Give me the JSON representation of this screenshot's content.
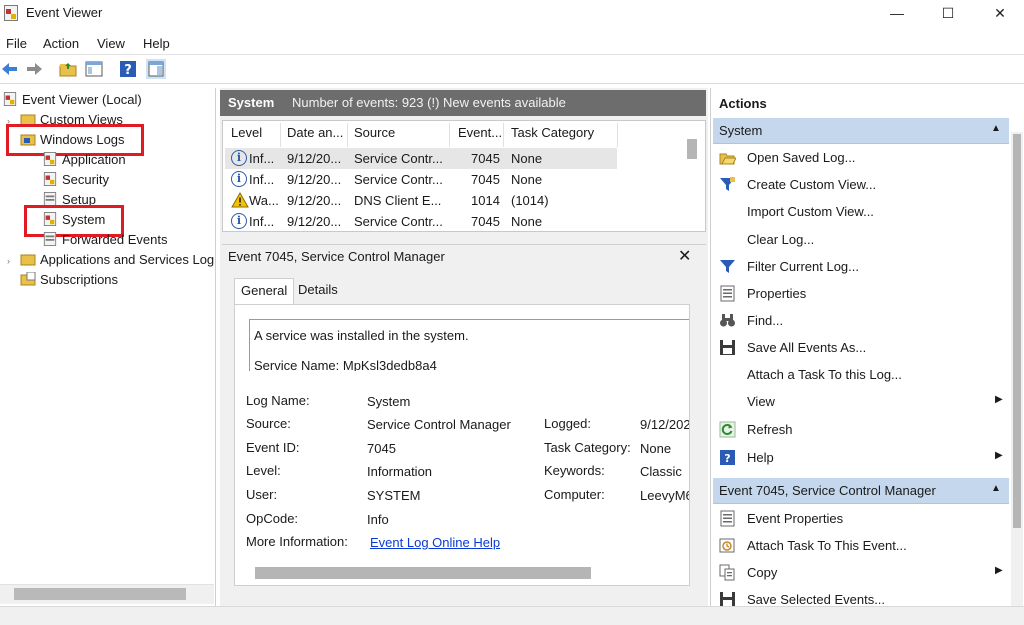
{
  "window": {
    "title": "Event Viewer",
    "controls": {
      "minimize": "—",
      "maximize": "☐",
      "close": "✕"
    }
  },
  "menu": [
    "File",
    "Action",
    "View",
    "Help"
  ],
  "toolbar": [
    "back-icon",
    "forward-icon",
    "folder-up-icon",
    "show-hide-console-tree-icon",
    "help-icon",
    "action-pane-icon"
  ],
  "tree": {
    "root": "Event Viewer (Local)",
    "custom_views": "Custom Views",
    "windows_logs": "Windows Logs",
    "children": [
      "Application",
      "Security",
      "Setup",
      "System",
      "Forwarded Events"
    ],
    "apps_services": "Applications and Services Log",
    "subscriptions": "Subscriptions"
  },
  "log_header": {
    "name": "System",
    "info": "Number of events: 923 (!) New events available"
  },
  "events": {
    "columns": [
      "Level",
      "Date an...",
      "Source",
      "Event...",
      "Task Category"
    ],
    "rows": [
      {
        "level": "Inf...",
        "date": "9/12/20...",
        "source": "Service Contr...",
        "event_id": "7045",
        "category": "None",
        "icon": "info-icon"
      },
      {
        "level": "Inf...",
        "date": "9/12/20...",
        "source": "Service Contr...",
        "event_id": "7045",
        "category": "None",
        "icon": "info-icon"
      },
      {
        "level": "Wa...",
        "date": "9/12/20...",
        "source": "DNS Client E...",
        "event_id": "1014",
        "category": "(1014)",
        "icon": "warning-icon"
      },
      {
        "level": "Inf...",
        "date": "9/12/20...",
        "source": "Service Contr...",
        "event_id": "7045",
        "category": "None",
        "icon": "info-icon"
      }
    ]
  },
  "detail": {
    "title": "Event 7045, Service Control Manager",
    "close": "✕",
    "tabs": [
      "General",
      "Details"
    ],
    "description_line1": "A service was installed in the system.",
    "description_line2": "Service Name:  MpKsl3dedb8a4",
    "fields": {
      "log_name_label": "Log Name:",
      "log_name": "System",
      "source_label": "Source:",
      "source": "Service Control Manager",
      "logged_label": "Logged:",
      "logged": "9/12/202",
      "event_id_label": "Event ID:",
      "event_id": "7045",
      "task_category_label": "Task Category:",
      "task_category": "None",
      "level_label": "Level:",
      "level": "Information",
      "keywords_label": "Keywords:",
      "keywords": "Classic",
      "user_label": "User:",
      "user": "SYSTEM",
      "computer_label": "Computer:",
      "computer": "LeevyM6",
      "opcode_label": "OpCode:",
      "opcode": "Info",
      "more_info_label": "More Information:",
      "more_info_link": "Event Log Online Help"
    }
  },
  "actions": {
    "title": "Actions",
    "section1": "System",
    "section1_items": [
      {
        "label": "Open Saved Log...",
        "icon": "open-folder-icon"
      },
      {
        "label": "Create Custom View...",
        "icon": "filter-icon"
      },
      {
        "label": "Import Custom View...",
        "icon": ""
      },
      {
        "label": "Clear Log...",
        "icon": ""
      },
      {
        "label": "Filter Current Log...",
        "icon": "filter-icon"
      },
      {
        "label": "Properties",
        "icon": "properties-icon"
      },
      {
        "label": "Find...",
        "icon": "binoculars-icon"
      },
      {
        "label": "Save All Events As...",
        "icon": "save-icon"
      },
      {
        "label": "Attach a Task To this Log...",
        "icon": ""
      },
      {
        "label": "View",
        "icon": "",
        "submenu": true
      },
      {
        "label": "Refresh",
        "icon": "refresh-icon"
      },
      {
        "label": "Help",
        "icon": "help-icon",
        "submenu": true
      }
    ],
    "section2": "Event 7045, Service Control Manager",
    "section2_items": [
      {
        "label": "Event Properties",
        "icon": "properties-icon"
      },
      {
        "label": "Attach Task To This Event...",
        "icon": "task-icon"
      },
      {
        "label": "Copy",
        "icon": "copy-icon",
        "submenu": true
      },
      {
        "label": "Save Selected Events...",
        "icon": "save-icon"
      }
    ],
    "submenu_arrow": "▶",
    "collapse_caret": "▲"
  },
  "colors": {
    "highlight_box": "#e01b24",
    "section_header": "#c5d7ec",
    "log_header_bg": "#6d6d6d",
    "link": "#0a3ad6"
  }
}
